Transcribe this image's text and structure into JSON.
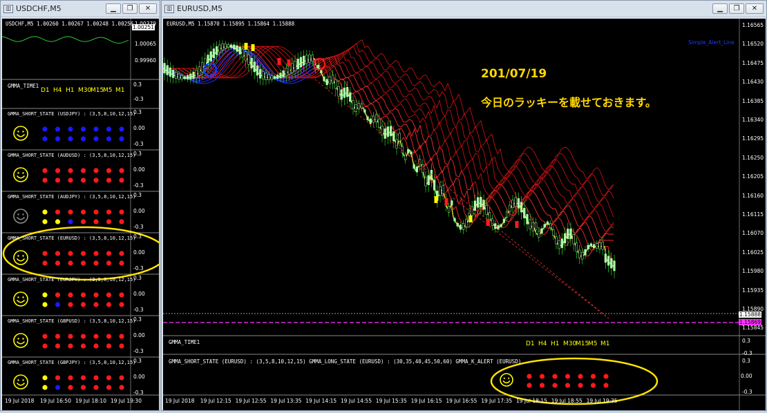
{
  "left_window": {
    "title": "USDCHF,M5",
    "symbol_line": "USDCHF,M5  1.00260 1.00267 1.00248 1.00256",
    "price_labels": [
      "1.00379",
      "1.00251",
      "1.00065",
      "0.99960"
    ],
    "price_tag": "1.00251",
    "gmma_time_label": "GMMA_TIME1",
    "timeframes": [
      "D1",
      "H4",
      "H1",
      "M30",
      "M15",
      "M5",
      "M1"
    ],
    "scale_top": "0.3",
    "scale_mid": "0.00",
    "scale_bottom": "-0.3",
    "panels": [
      {
        "label": "GMMA_SHORT_STATE (USDJPY) : (3,5,8,10,12,15)",
        "smiley": "yellow",
        "row1": [
          "blue",
          "blue",
          "blue",
          "blue",
          "blue",
          "blue",
          "blue"
        ],
        "row2": [
          "blue",
          "blue",
          "blue",
          "blue",
          "blue",
          "blue",
          "blue"
        ]
      },
      {
        "label": "GMMA_SHORT_STATE (AUDUSD) : (3,5,8,10,12,15)",
        "smiley": "yellow",
        "row1": [
          "red",
          "red",
          "red",
          "red",
          "red",
          "red",
          "red"
        ],
        "row2": [
          "red",
          "red",
          "red",
          "red",
          "red",
          "red",
          "red"
        ]
      },
      {
        "label": "GMMA_SHORT_STATE (AUDJPY) : (3,5,8,10,12,15)",
        "smiley": "gray",
        "row1": [
          "yellow",
          "red",
          "red",
          "red",
          "red",
          "red",
          "red"
        ],
        "row2": [
          "yellow",
          "yellow",
          "blue",
          "red",
          "red",
          "red",
          "red"
        ]
      },
      {
        "label": "GMMA_SHORT_STATE (EURUSD) : (3,5,8,10,12,15)",
        "smiley": "yellow",
        "row1": [
          "red",
          "red",
          "red",
          "red",
          "red",
          "red",
          "red"
        ],
        "row2": [
          "red",
          "red",
          "red",
          "red",
          "red",
          "red",
          "red"
        ]
      },
      {
        "label": "GMMA_SHORT_STATE (EURJPY) : (3,5,8,10,12,15)",
        "smiley": "yellow",
        "row1": [
          "yellow",
          "red",
          "red",
          "red",
          "red",
          "red",
          "red"
        ],
        "row2": [
          "yellow",
          "blue",
          "red",
          "red",
          "red",
          "red",
          "red"
        ]
      },
      {
        "label": "GMMA_SHORT_STATE (GBPUSD) : (3,5,8,10,12,15)",
        "smiley": "yellow",
        "row1": [
          "red",
          "red",
          "red",
          "red",
          "red",
          "red",
          "red"
        ],
        "row2": [
          "red",
          "red",
          "red",
          "red",
          "red",
          "red",
          "red"
        ]
      },
      {
        "label": "GMMA_SHORT_STATE (GBPJPY) : (3,5,8,10,12,15)",
        "smiley": "yellow",
        "row1": [
          "yellow",
          "red",
          "red",
          "red",
          "red",
          "red",
          "red"
        ],
        "row2": [
          "yellow",
          "blue",
          "red",
          "red",
          "red",
          "red",
          "red"
        ]
      }
    ],
    "time_axis": [
      "19 Jul 2018",
      "19 Jul 16:50",
      "19 Jul 18:10",
      "19 Jul 19:30"
    ]
  },
  "right_window": {
    "title": "EURUSD,M5",
    "symbol_line": "EURUSD,M5  1.15870 1.15895 1.15864 1.15888",
    "alert_label": "Simple_Alert_Line",
    "overlay_date": "201/07/19",
    "overlay_message": "今日のラッキーを載せておきます。",
    "price_labels": [
      "1.16565",
      "1.16520",
      "1.16475",
      "1.16430",
      "1.16385",
      "1.16340",
      "1.16295",
      "1.16250",
      "1.16205",
      "1.16160",
      "1.16115",
      "1.16070",
      "1.16025",
      "1.15980",
      "1.15935",
      "1.15890",
      "1.15845"
    ],
    "price_tag_current": "1.15888",
    "price_tag_alert": "1.15869",
    "gmma_time_label": "GMMA_TIME1",
    "timeframes": [
      "D1",
      "H4",
      "H1",
      "M30",
      "M15",
      "M5",
      "M1"
    ],
    "scale_top": "0.3",
    "scale_mid": "0.00",
    "scale_bottom": "-0.3",
    "bottom_panel_label": "GMMA_SHORT_STATE (EURUSD) : (3,5,8,10,12,15)  GMMA_LONG_STATE (EURUSD) : (30,35,40,45,50,60)  GMMA_K_ALERT (EURUSD)",
    "bottom_dots_row1": [
      "red",
      "red",
      "red",
      "red",
      "red",
      "red",
      "red"
    ],
    "bottom_dots_row2": [
      "red",
      "red",
      "red",
      "red",
      "red",
      "red",
      "red"
    ],
    "time_axis": [
      "19 Jul 2018",
      "19 Jul 12:15",
      "19 Jul 12:55",
      "19 Jul 13:35",
      "19 Jul 14:15",
      "19 Jul 14:55",
      "19 Jul 15:35",
      "19 Jul 16:15",
      "19 Jul 16:55",
      "19 Jul 17:35",
      "19 Jul 18:15",
      "19 Jul 18:55",
      "19 Jul 19:35"
    ]
  },
  "colors": {
    "red": "#ff1a1a",
    "blue": "#1a1aff",
    "yellow": "#ffff00",
    "gray": "#8c8c8c",
    "annotation": "#ffe400",
    "candle_up": "#aaffaa",
    "wick": "#22c022"
  },
  "icons": {
    "minimize": "minimize-icon",
    "restore": "restore-icon",
    "close": "close-icon",
    "smiley": "smiley-icon"
  }
}
